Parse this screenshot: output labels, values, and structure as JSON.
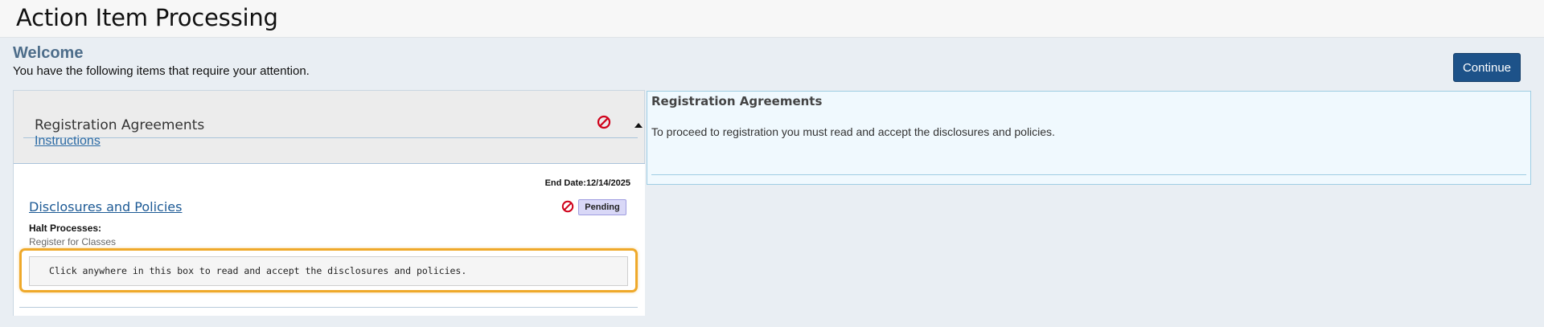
{
  "header": {
    "title": "Action Item Processing"
  },
  "welcome": {
    "heading": "Welcome",
    "message": "You have the following items that require your attention.",
    "continue_label": "Continue"
  },
  "accordion": {
    "title": "Registration Agreements",
    "instructions_label": "Instructions",
    "status_icon": "halt-icon",
    "collapse_icon": "caret-up-icon"
  },
  "item": {
    "end_date_label": "End Date:",
    "end_date_value": "12/14/2025",
    "title": "Disclosures and Policies",
    "status": "Pending",
    "halt_processes_label": "Halt Processes:",
    "halt_processes_value": "Register for Classes",
    "accept_prompt": "Click anywhere in this box to read and accept the disclosures and policies."
  },
  "details": {
    "title": "Registration Agreements",
    "text": "To proceed to registration you must read and accept the disclosures and policies."
  },
  "colors": {
    "accent": "#1d5289",
    "halt_red": "#d0021b",
    "focus_outline": "#efa92a",
    "pending_badge": "#d9d8f7"
  }
}
